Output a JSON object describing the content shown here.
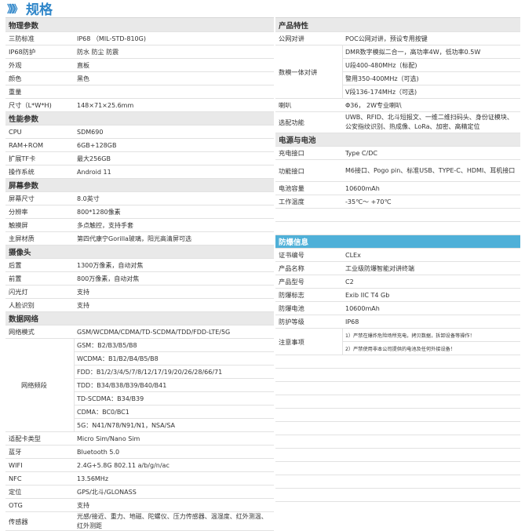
{
  "header": {
    "chevrons": "》》》",
    "title": "规格"
  },
  "left": {
    "sections": [
      {
        "title": "物理参数",
        "rows": [
          {
            "label": "三防标准",
            "value": "IP68 （MIL-STD-810G)"
          },
          {
            "label": "IP68防护",
            "value": "防水 防尘 防震"
          },
          {
            "label": "外观",
            "value": "直板"
          },
          {
            "label": "颜色",
            "value": "黑色"
          },
          {
            "label": "重量",
            "value": ""
          },
          {
            "label": "尺寸（L*W*H)",
            "value": "148×71×25.6mm"
          }
        ]
      },
      {
        "title": "性能参数",
        "rows": [
          {
            "label": "CPU",
            "value": "SDM690"
          },
          {
            "label": "RAM+ROM",
            "value": "6GB+128GB"
          },
          {
            "label": "扩展TF卡",
            "value": "最大256GB"
          },
          {
            "label": "操作系统",
            "value": "Android 11"
          }
        ]
      },
      {
        "title": "屏幕参数",
        "rows": [
          {
            "label": "屏幕尺寸",
            "value": "8.0英寸"
          },
          {
            "label": "分辨率",
            "value": "800*1280像素"
          },
          {
            "label": "触摸屏",
            "value": "多点触控，支持手套"
          },
          {
            "label": "主屏材质",
            "value": "第四代康宁Gorilla玻璃，阳光高清屏可选"
          }
        ]
      },
      {
        "title": "摄像头",
        "rows": [
          {
            "label": "后置",
            "value": "1300万像素，自动对焦"
          },
          {
            "label": "前置",
            "value": "800万像素，自动对焦"
          },
          {
            "label": "闪光灯",
            "value": "支持"
          },
          {
            "label": "人脸识别",
            "value": "支持"
          }
        ]
      },
      {
        "title": "数据网络",
        "rows": [
          {
            "label": "网络模式",
            "value": "GSM/WCDMA/CDMA/TD-SCDMA/TDD/FDD-LTE/5G"
          }
        ]
      }
    ],
    "bands_label": "网络频段",
    "bands": [
      "GSM：B2/B3/B5/B8",
      "WCDMA：B1/B2/B4/B5/B8",
      "FDD：B1/2/3/4/5/7/8/12/17/19/20/26/28/66/71",
      "TDD：B34/B38/B39/B40/B41",
      "TD-SCDMA：B34/B39",
      "CDMA：BC0/BC1",
      "5G：N41/N78/N91/N1，NSA/SA"
    ],
    "tail": [
      {
        "label": "适配卡类型",
        "value": "Micro Sim/Nano Sim"
      },
      {
        "label": "蓝牙",
        "value": "Bluetooth 5.0"
      },
      {
        "label": "WIFI",
        "value": "2.4G+5.8G 802.11 a/b/g/n/ac"
      },
      {
        "label": "NFC",
        "value": "13.56MHz"
      },
      {
        "label": "定位",
        "value": "GPS/北斗/GLONASS"
      },
      {
        "label": "OTG",
        "value": "支持"
      },
      {
        "label": "传感器",
        "value": "光感/接近、重力、地磁、陀螺仪、压力传感器、温湿度、红外测温、红外测距"
      }
    ]
  },
  "right": {
    "features_title": "产品特性",
    "public_talk": {
      "label": "公网对讲",
      "value": "POC公网对讲，预设专用按键"
    },
    "dmr": {
      "label": "数模一体对讲",
      "lines": [
        "DMR数字模拟二合一，高功率4W，低功率0.5W",
        "U段400-480MHz（标配)",
        "警用350-400MHz（可选)",
        "V段136-174MHz（可选)"
      ]
    },
    "speaker": {
      "label": "喇叭",
      "value": "Φ36，  2W专业喇叭"
    },
    "options": {
      "label": "选配功能",
      "value": "UWB、RFID、北斗短报文、一维二维扫码头、身份证模块、公安指纹识别、热成像、LoRa、加密、高精定位"
    },
    "power_title": "电源与电池",
    "charge": {
      "label": "充电接口",
      "value": "Type C/DC"
    },
    "ports": {
      "label": "功能接口",
      "value": "M6接口、Pogo pin、标准USB、TYPE-C、HDMI、耳机接口"
    },
    "battery": {
      "label": "电池容量",
      "value": "10600mAh"
    },
    "temp": {
      "label": "工作温度",
      "value": "-35℃～ +70℃"
    },
    "ex_title": "防爆信息",
    "ex_rows": [
      {
        "label": "证书编号",
        "value": "CLEx"
      },
      {
        "label": "产品名称",
        "value": "工业级防爆智能对讲终端"
      },
      {
        "label": "产品型号",
        "value": "C2"
      },
      {
        "label": "防爆标志",
        "value": "Exib IIC T4 Gb"
      },
      {
        "label": "防爆电池",
        "value": "10600mAh"
      },
      {
        "label": "防护等级",
        "value": "IP68"
      }
    ],
    "notes_label": "注意事项",
    "notes": [
      "1）严禁在爆炸危险场所充电，拷贝数据，拆卸设备等操作！",
      "2）严禁使用非本公司提供的电池及任何外接设备！"
    ],
    "colors": {
      "accent": "#2f86c9",
      "ex_header": "#4fb0d8",
      "section_bg": "#e9e9e9"
    }
  }
}
